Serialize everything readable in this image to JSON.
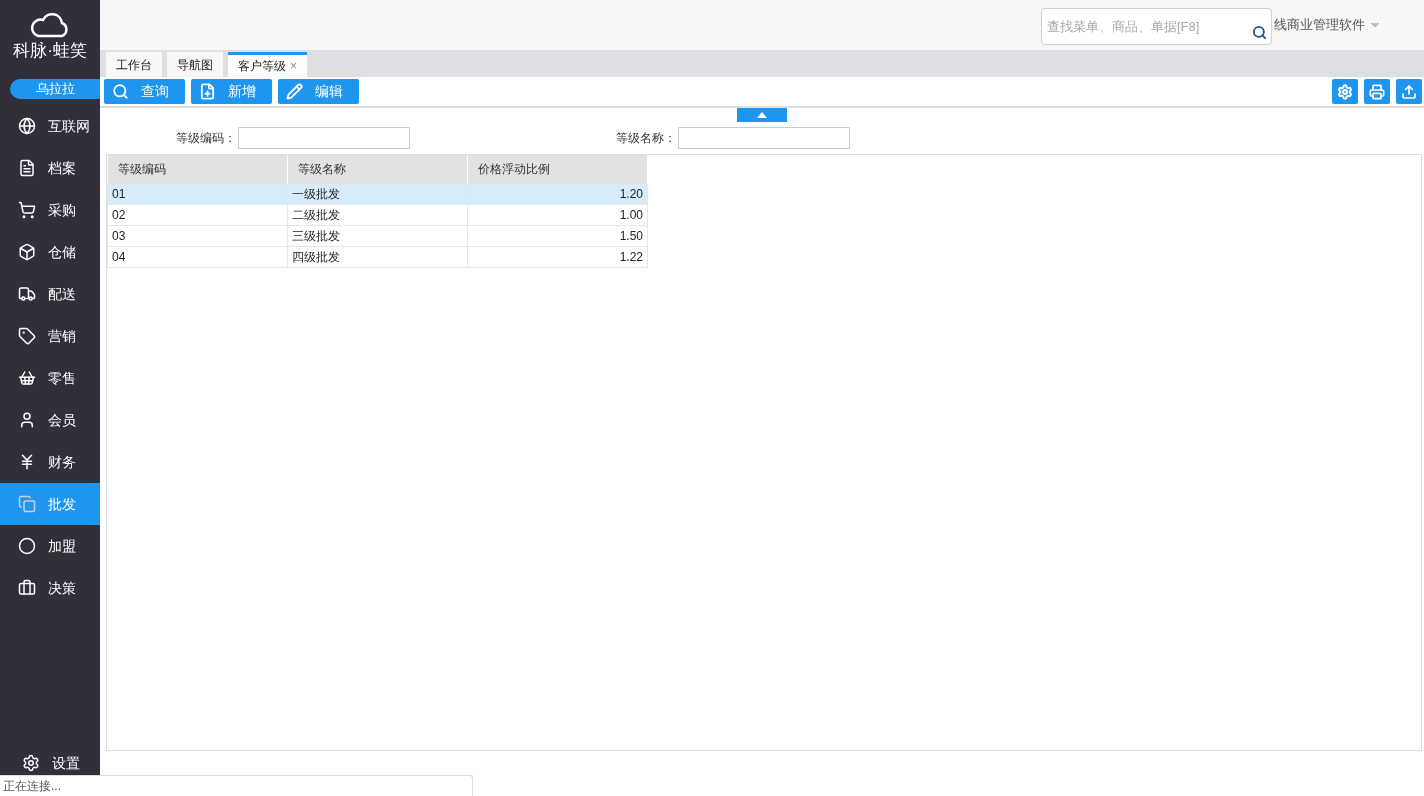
{
  "sidebar": {
    "logo": "科脉·蛙笑",
    "user": "乌拉拉",
    "items": [
      {
        "label": "互联网",
        "selected": false
      },
      {
        "label": "档案",
        "selected": false
      },
      {
        "label": "采购",
        "selected": false
      },
      {
        "label": "仓储",
        "selected": false
      },
      {
        "label": "配送",
        "selected": false
      },
      {
        "label": "营销",
        "selected": false
      },
      {
        "label": "零售",
        "selected": false
      },
      {
        "label": "会员",
        "selected": false
      },
      {
        "label": "财务",
        "selected": false
      },
      {
        "label": "批发",
        "selected": true
      },
      {
        "label": "加盟",
        "selected": false
      },
      {
        "label": "决策",
        "selected": false
      }
    ],
    "settings": "设置"
  },
  "header": {
    "search": {
      "placeholder": "查找菜单、商品、单据[F8]"
    },
    "product": "线商业管理软件"
  },
  "tabs": [
    {
      "label": "工作台",
      "selected": false,
      "closable": false
    },
    {
      "label": "导航图",
      "selected": false,
      "closable": false
    },
    {
      "label": "客户等级",
      "selected": true,
      "closable": true
    }
  ],
  "close_mark": "×",
  "toolbar": {
    "buttons": [
      "查询",
      "新增",
      "编辑"
    ]
  },
  "filters": [
    {
      "label": "等级编码："
    },
    {
      "label": "等级名称："
    }
  ],
  "table": {
    "columns": [
      "等级编码",
      "等级名称",
      "价格浮动比例"
    ],
    "rows": [
      {
        "cells": [
          "01",
          "一级批发",
          "1.20"
        ],
        "selected": true
      },
      {
        "cells": [
          "02",
          "二级批发",
          "1.00"
        ],
        "selected": false
      },
      {
        "cells": [
          "03",
          "三级批发",
          "1.50"
        ],
        "selected": false
      },
      {
        "cells": [
          "04",
          "四级批发",
          "1.22"
        ],
        "selected": false
      }
    ]
  },
  "status_bar": "正在连接..."
}
